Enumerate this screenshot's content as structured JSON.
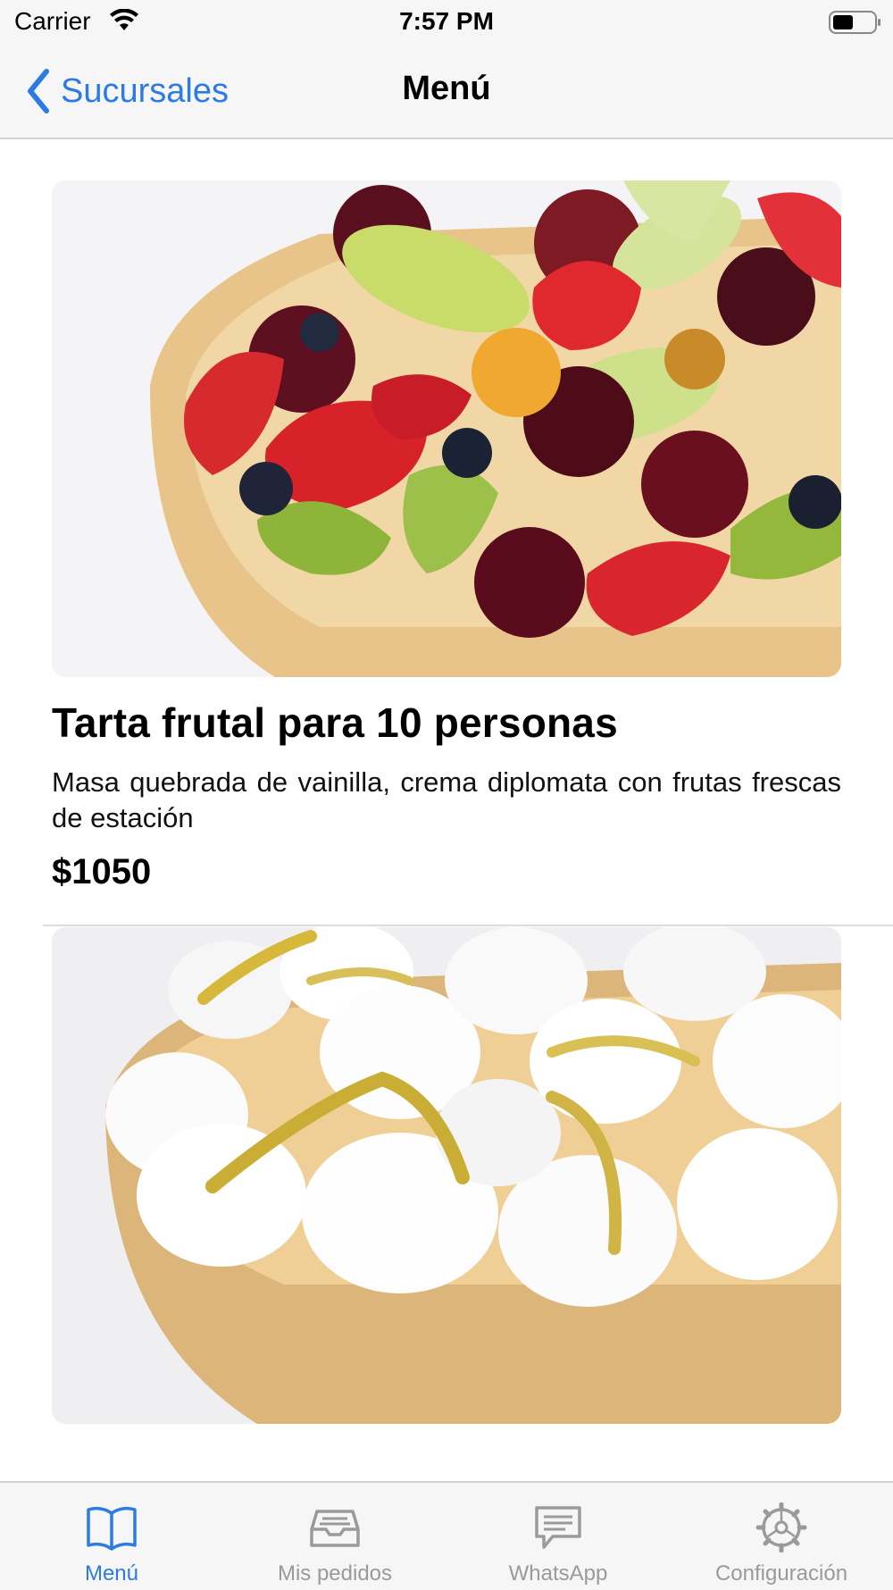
{
  "status_bar": {
    "carrier": "Carrier",
    "time": "7:57 PM"
  },
  "nav": {
    "back_label": "Sucursales",
    "title": "Menú"
  },
  "products": [
    {
      "name": "Tarta frutal para 10 personas",
      "description": "Masa quebrada de vainilla, crema diplomata con frutas frescas de estación",
      "price": "$1050"
    },
    {
      "name": "",
      "description": "",
      "price": ""
    }
  ],
  "tabs": [
    {
      "label": "Menú",
      "icon": "book-icon",
      "active": true
    },
    {
      "label": "Mis pedidos",
      "icon": "tray-icon",
      "active": false
    },
    {
      "label": "WhatsApp",
      "icon": "message-icon",
      "active": false
    },
    {
      "label": "Configuración",
      "icon": "gear-icon",
      "active": false
    }
  ],
  "colors": {
    "accent": "#2c7be5",
    "inactive": "#9a9a9a",
    "bar_bg": "#f6f6f6"
  }
}
